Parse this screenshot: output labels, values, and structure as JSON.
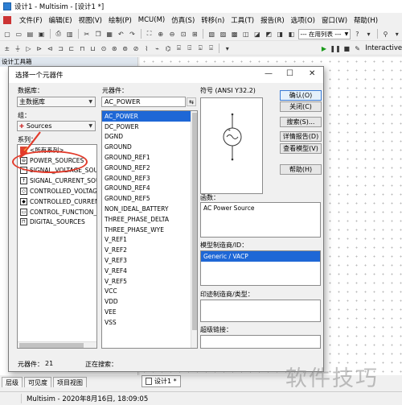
{
  "window": {
    "title": "设计1 - Multisim - [设计1 *]"
  },
  "menu": [
    "文件(F)",
    "编辑(E)",
    "视图(V)",
    "绘制(P)",
    "MCU(M)",
    "仿真(S)",
    "转移(n)",
    "工具(T)",
    "报告(R)",
    "选项(O)",
    "窗口(W)",
    "帮助(H)"
  ],
  "toolbar": {
    "in_use_list": "--- 在用列表 ---",
    "interactive": "Interactive"
  },
  "project_panel": {
    "title": "设计工具箱"
  },
  "dialog": {
    "title": "选择一个元器件",
    "database_label": "数据库：",
    "database_value": "主数据库",
    "group_label": "组：",
    "group_value": "Sources",
    "series_label": "系列：",
    "series": [
      {
        "label": "<所有系列>",
        "icon": "all-series-icon"
      },
      {
        "label": "POWER_SOURCES",
        "icon": "power-source-icon",
        "selected": false
      },
      {
        "label": "SIGNAL_VOLTAGE_SOU",
        "icon": "signal-voltage-icon"
      },
      {
        "label": "SIGNAL_CURRENT_SOU",
        "icon": "signal-current-icon"
      },
      {
        "label": "CONTROLLED_VOLTAGE",
        "icon": "controlled-voltage-icon"
      },
      {
        "label": "CONTROLLED_CURRENT",
        "icon": "controlled-current-icon"
      },
      {
        "label": "CONTROL_FUNCTION_B",
        "icon": "control-function-icon"
      },
      {
        "label": "DIGITAL_SOURCES",
        "icon": "digital-source-icon"
      }
    ],
    "component_label": "元器件：",
    "component_search": "AC_POWER",
    "components": [
      "AC_POWER",
      "DC_POWER",
      "DGND",
      "GROUND",
      "GROUND_REF1",
      "GROUND_REF2",
      "GROUND_REF3",
      "GROUND_REF4",
      "GROUND_REF5",
      "NON_IDEAL_BATTERY",
      "THREE_PHASE_DELTA",
      "THREE_PHASE_WYE",
      "V_REF1",
      "V_REF2",
      "V_REF3",
      "V_REF4",
      "V_REF5",
      "VCC",
      "VDD",
      "VEE",
      "VSS"
    ],
    "selected_component": "AC_POWER",
    "symbol_label": "符号 (ANSI Y32.2)",
    "function_label": "函数：",
    "function_value": "AC Power Source",
    "model_label": "模型制造商/ID：",
    "model_value": "Generic / VACP",
    "footprint_label": "印迹制造商/类型：",
    "hyperlink_label": "超级链接：",
    "buttons": {
      "confirm": "确认(O)",
      "close": "关闭(C)",
      "search": "搜索(S)...",
      "detail_report": "详情报告(D)",
      "view_model": "查看模型(V)",
      "help": "帮助(H)"
    },
    "component_count_label": "元器件：",
    "component_count": "21",
    "searching_label": "正在搜索："
  },
  "bottom_tabs": [
    "层级",
    "可见度",
    "项目视图"
  ],
  "document_tab": "设计1 *",
  "status": {
    "text": "Multisim  -  2020年8月16日, 18:09:05"
  },
  "watermark": "软件技巧",
  "colors": {
    "selection": "#1e67d6",
    "callout": "#e23a2a"
  }
}
